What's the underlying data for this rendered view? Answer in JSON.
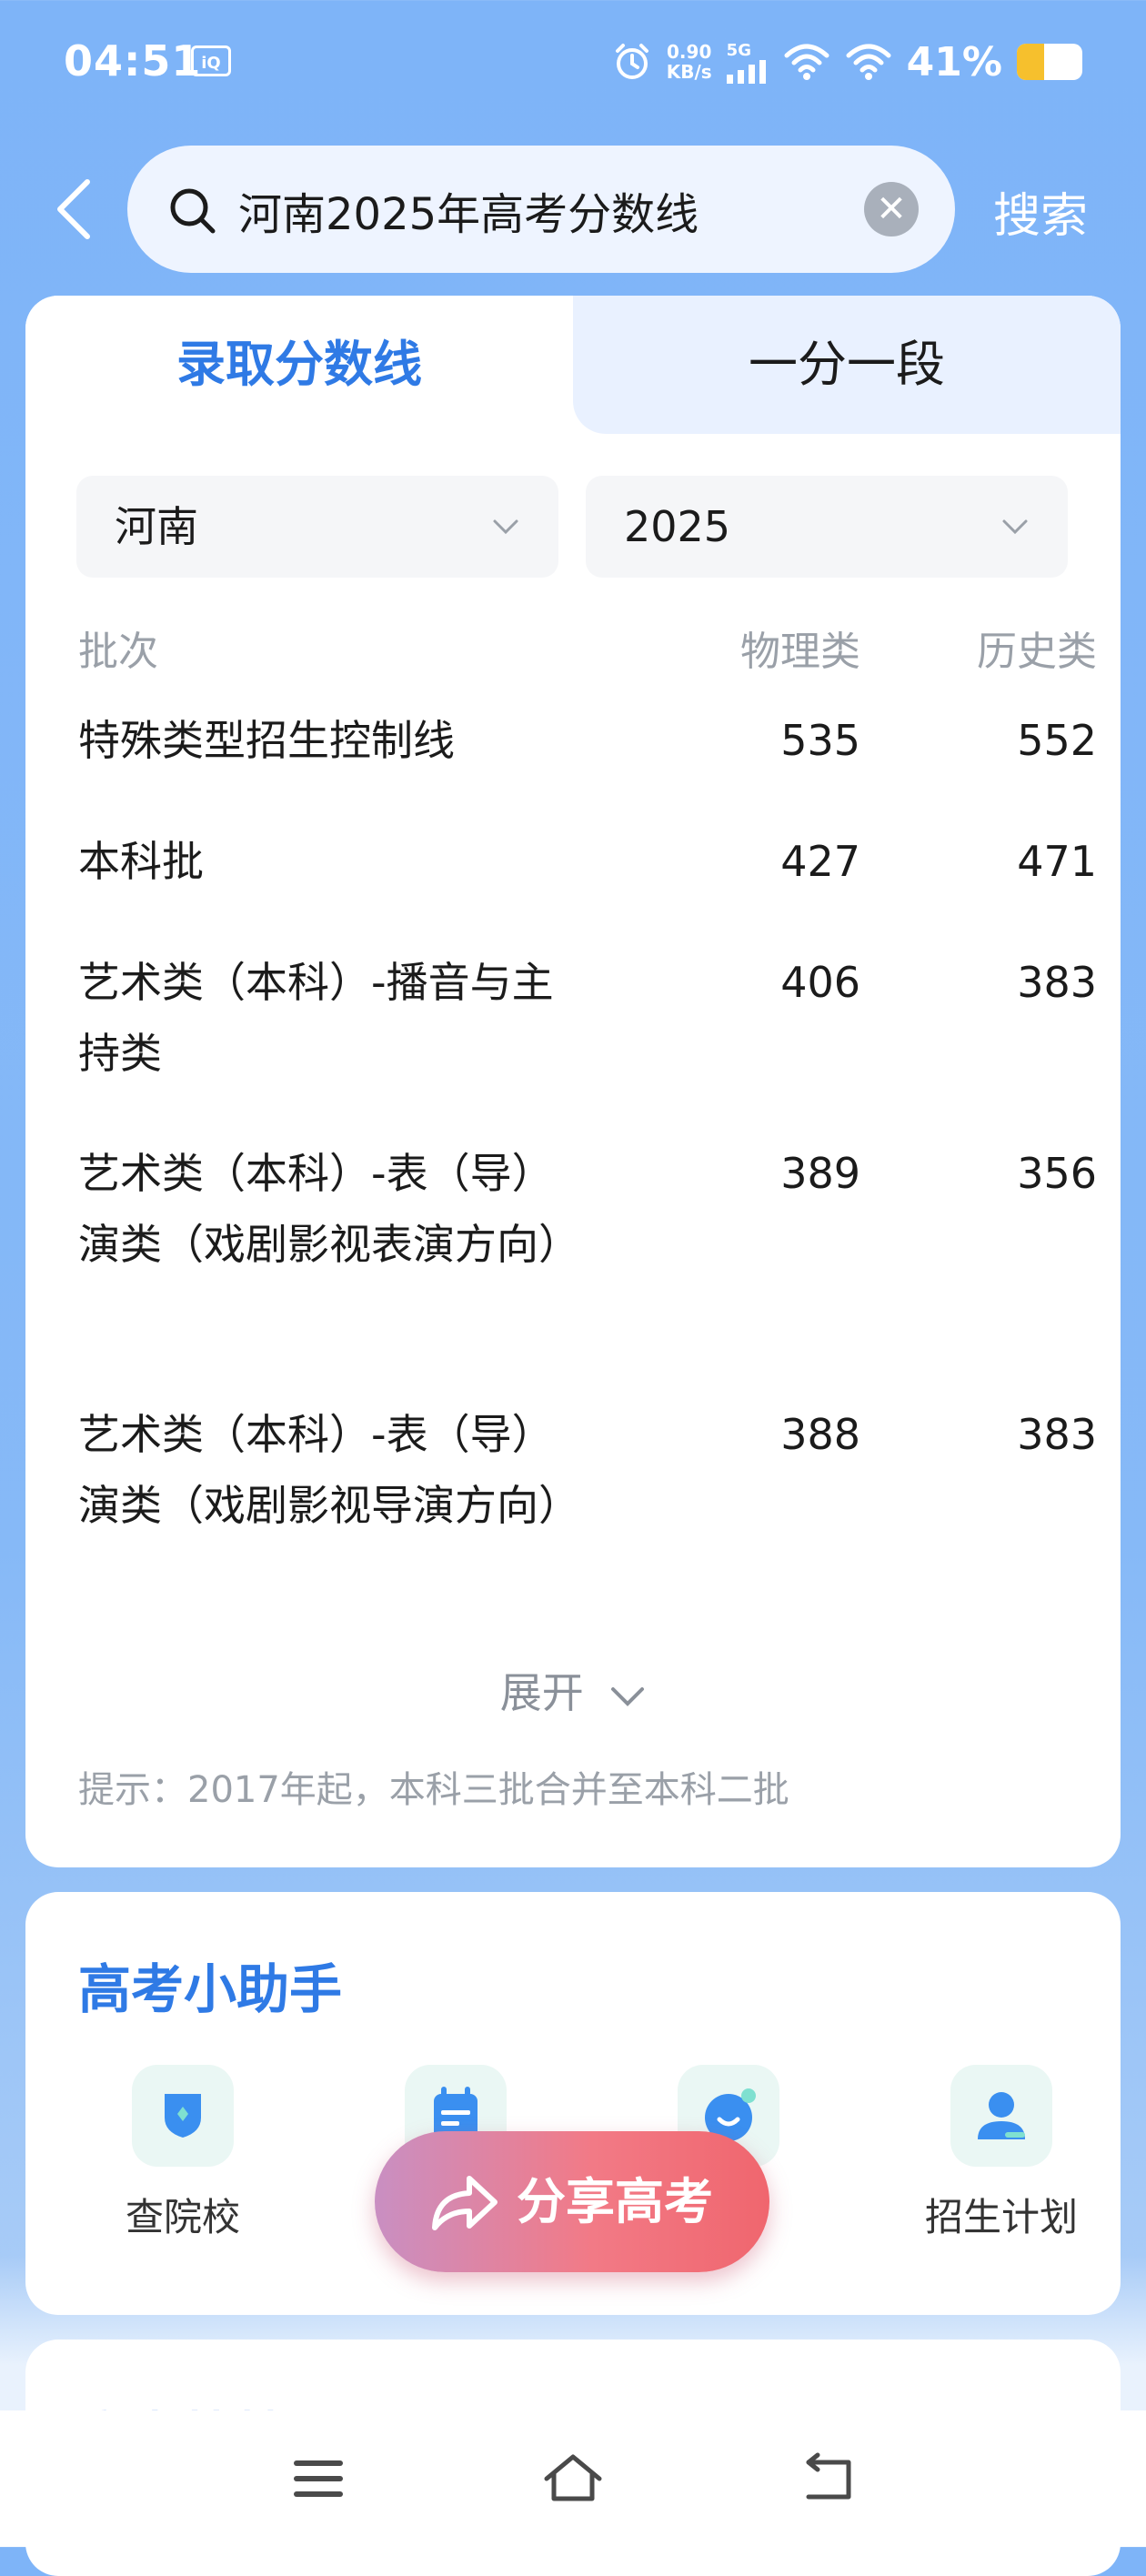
{
  "status_bar": {
    "time": "04:51",
    "app_badge": "QIYI",
    "net_speed_value": "0.90",
    "net_speed_unit": "KB/s",
    "network": "5G",
    "battery_percent": "41%",
    "battery_level": 0.41
  },
  "search": {
    "query": "河南2025年高考分数线",
    "button_label": "搜索"
  },
  "tabs": [
    {
      "label": "录取分数线",
      "active": true
    },
    {
      "label": "一分一段",
      "active": false
    }
  ],
  "filters": {
    "province": "河南",
    "year": "2025"
  },
  "table": {
    "headers": [
      "批次",
      "物理类",
      "历史类"
    ],
    "rows": [
      {
        "name": "特殊类型招生控制线",
        "physics": "535",
        "history": "552"
      },
      {
        "name": "本科批",
        "physics": "427",
        "history": "471"
      },
      {
        "name": "艺术类（本科）-播音与主持类",
        "physics": "406",
        "history": "383"
      },
      {
        "name": "艺术类（本科）-表（导）演类（戏剧影视表演方向）",
        "physics": "389",
        "history": "356"
      },
      {
        "name": "艺术类（本科）-表（导）演类（戏剧影视导演方向）",
        "physics": "388",
        "history": "383"
      }
    ],
    "expand_label": "展开",
    "hint": "提示：2017年起，本科三批合并至本科二批"
  },
  "helper": {
    "title": "高考小助手",
    "tools": [
      {
        "label": "查院校"
      },
      {
        "label": ""
      },
      {
        "label": "手"
      },
      {
        "label": "招生计划"
      }
    ]
  },
  "share_button": {
    "label": "分享高考"
  },
  "next_card": {
    "title_partial": "高考快捷"
  },
  "colors": {
    "accent": "#2f7ae5",
    "background": "#7eb4f8"
  }
}
